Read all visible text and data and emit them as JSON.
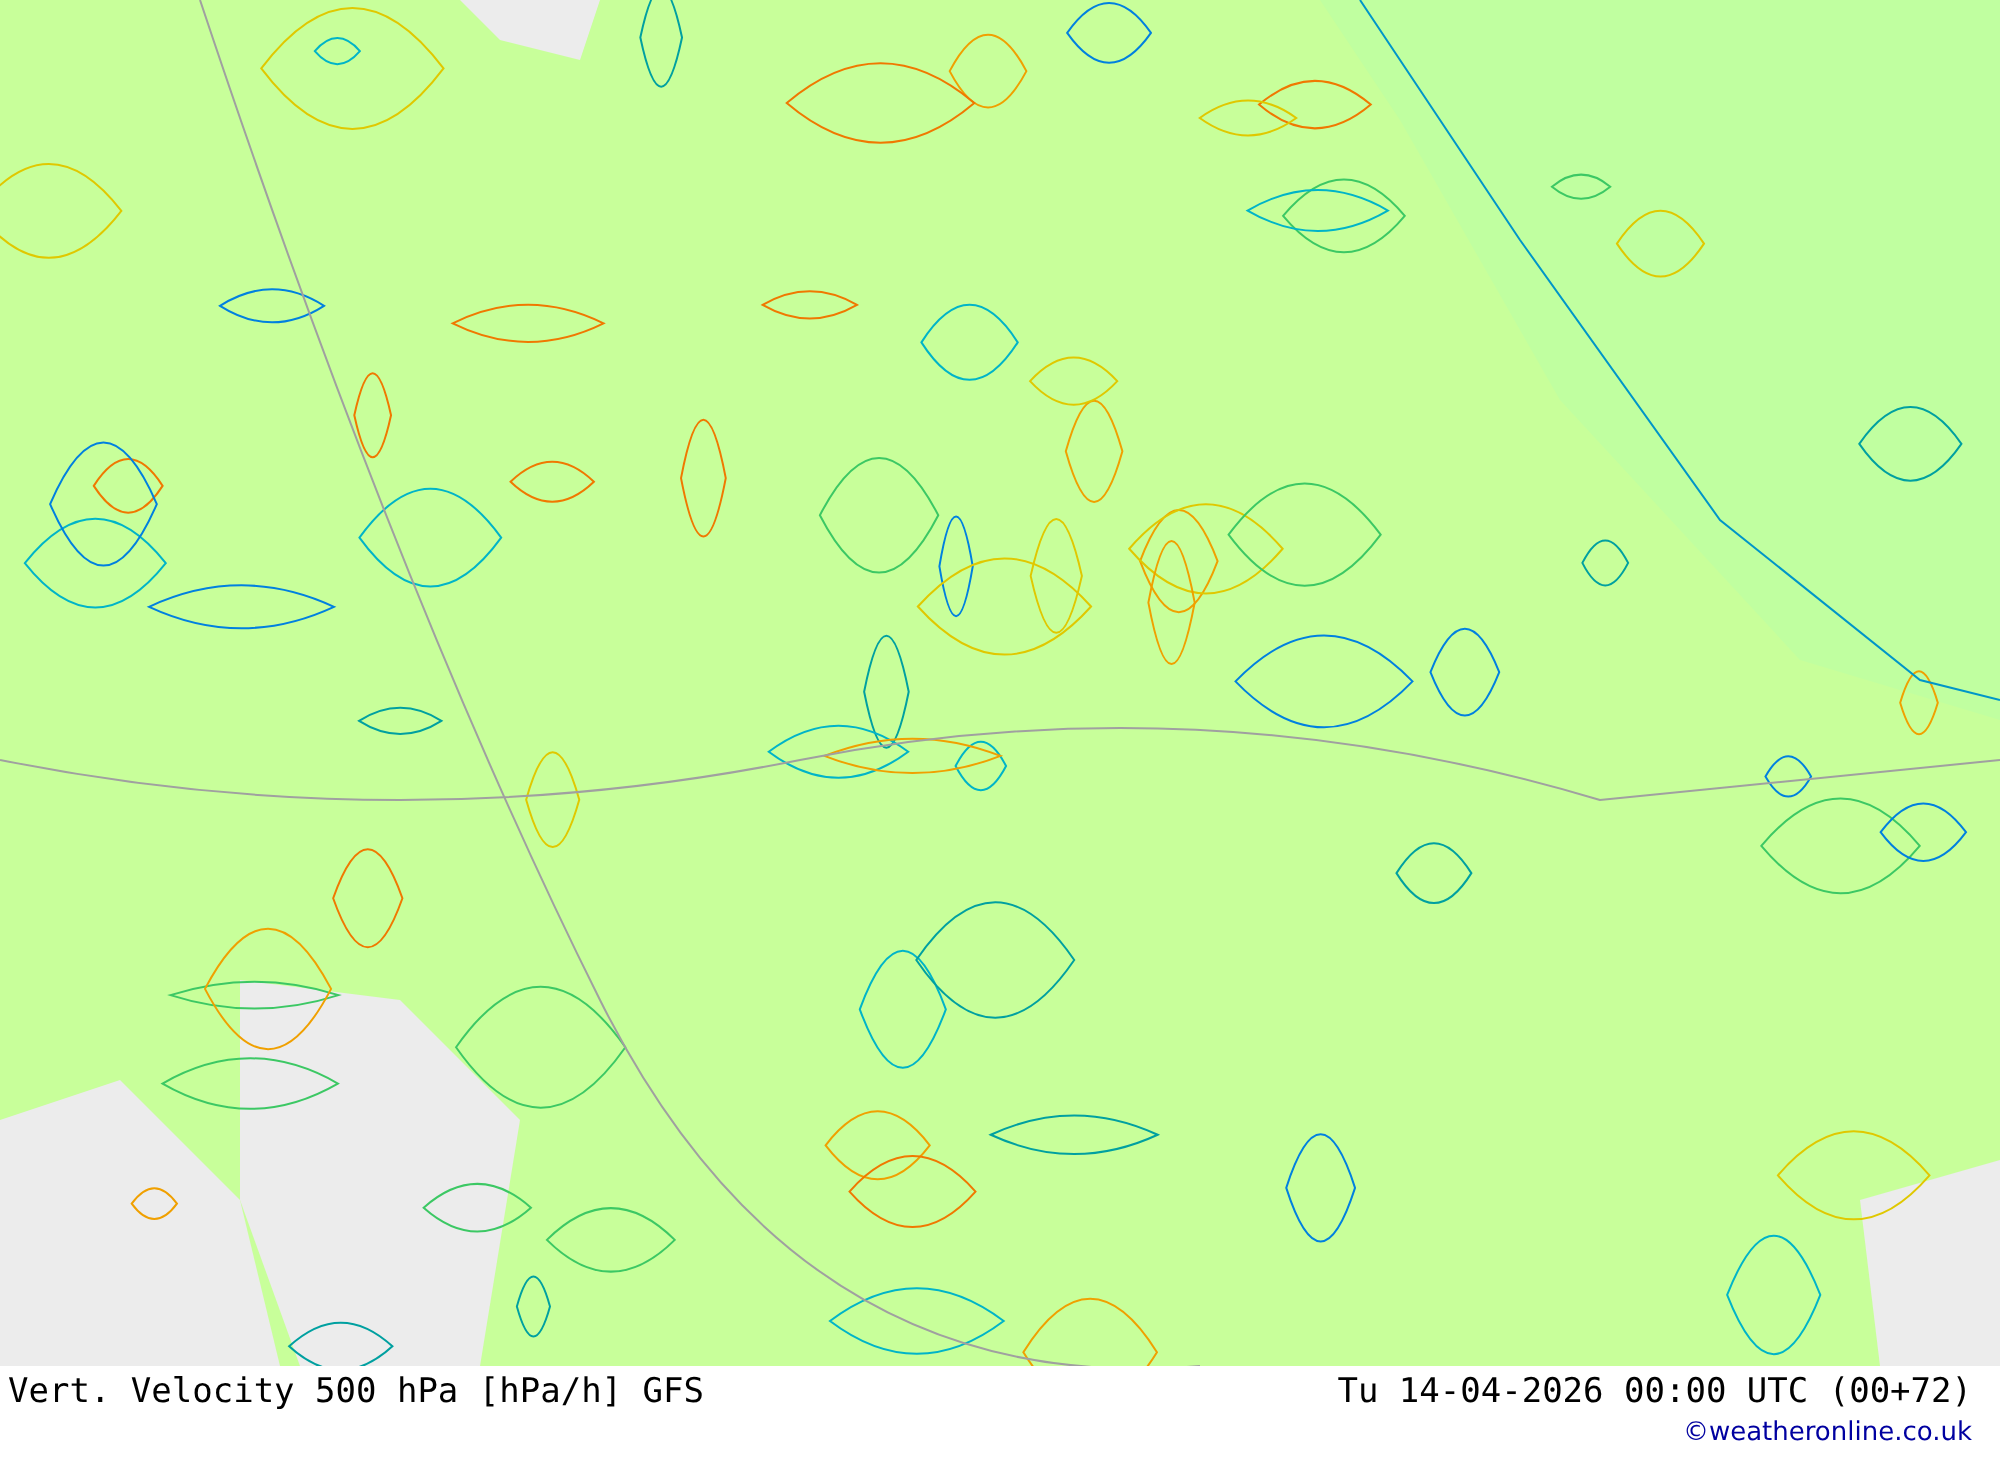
{
  "map": {
    "title": "Vert. Velocity 500 hPa [hPa/h] GFS",
    "valid_time": "Tu 14-04-2026 00:00 UTC (00+72)",
    "credit": "©weatheronline.co.uk"
  }
}
